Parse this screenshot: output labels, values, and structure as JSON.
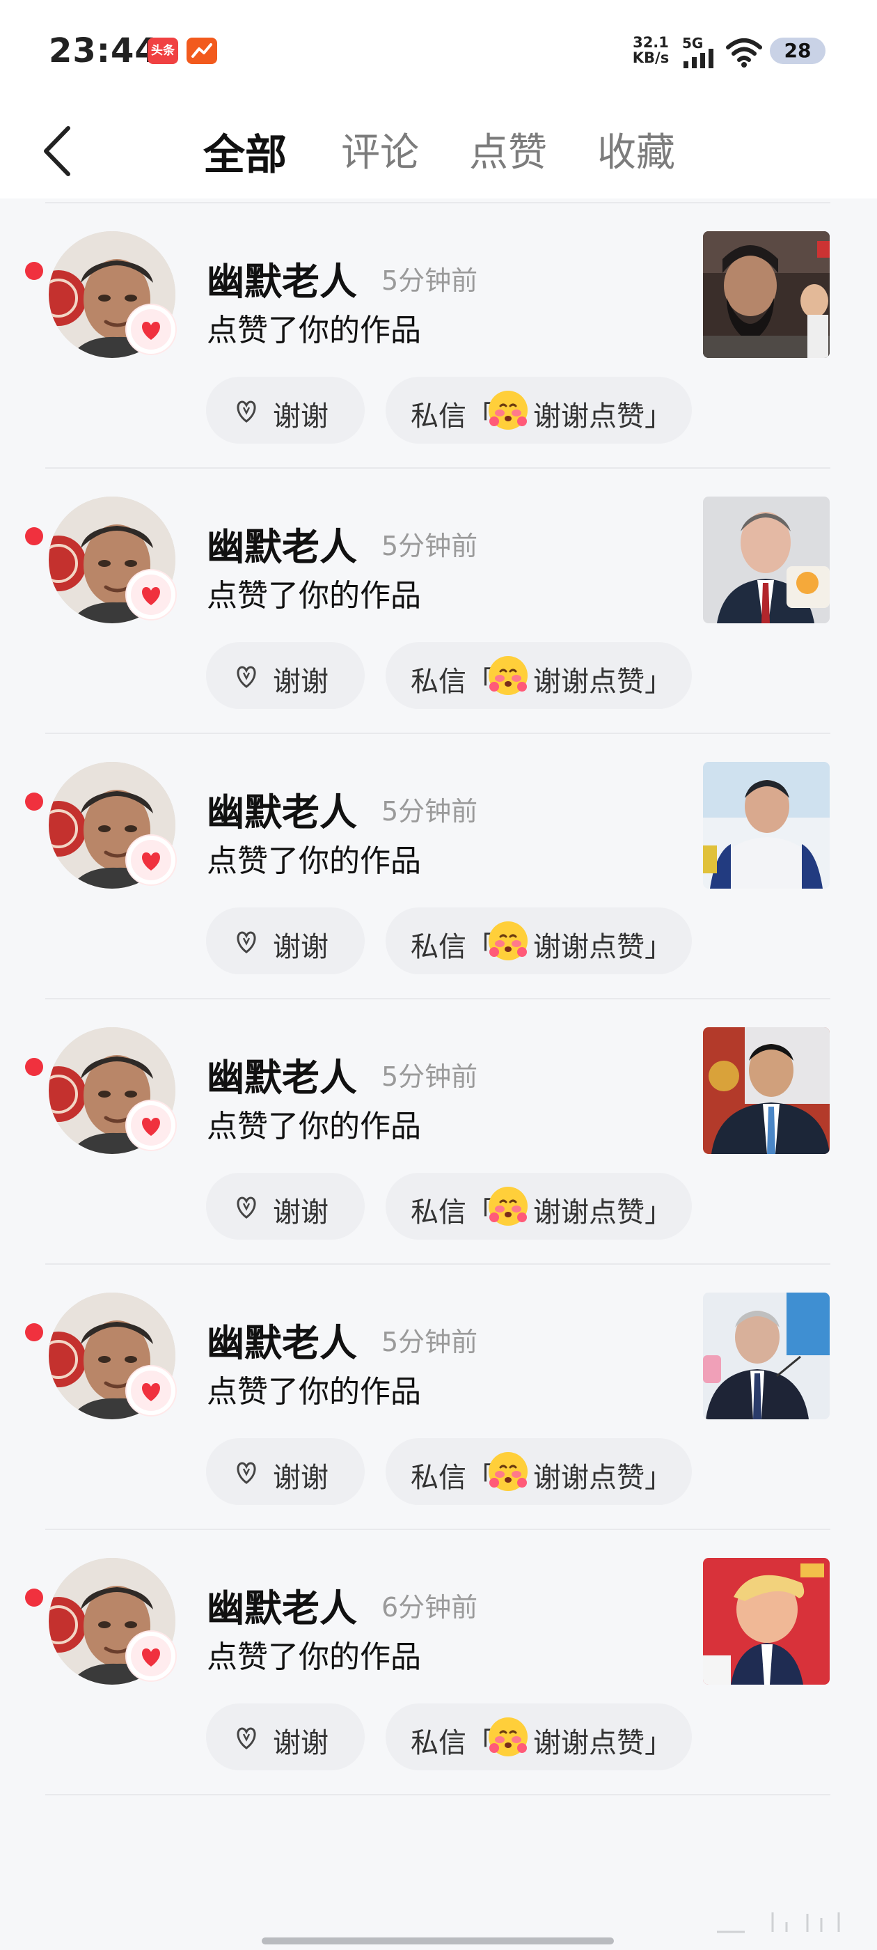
{
  "status_bar": {
    "time": "23:44",
    "app_badge": "头条",
    "net_speed_value": "32.1",
    "net_speed_unit": "KB/s",
    "network": "5G",
    "battery": "28"
  },
  "header": {
    "tabs": [
      {
        "label": "全部",
        "active": true
      },
      {
        "label": "评论",
        "active": false
      },
      {
        "label": "点赞",
        "active": false
      },
      {
        "label": "收藏",
        "active": false
      }
    ]
  },
  "items": [
    {
      "name": "幽默老人",
      "time": "",
      "action": "点赞了你的作品",
      "thanks": "谢谢",
      "dm_prefix": "私信「",
      "dm_message": "谢谢点赞」",
      "unread": false
    },
    {
      "name": "幽默老人",
      "time": "5分钟前",
      "action": "点赞了你的作品",
      "thanks": "谢谢",
      "dm_prefix": "私信「",
      "dm_message": "谢谢点赞」",
      "unread": true
    },
    {
      "name": "幽默老人",
      "time": "5分钟前",
      "action": "点赞了你的作品",
      "thanks": "谢谢",
      "dm_prefix": "私信「",
      "dm_message": "谢谢点赞」",
      "unread": true
    },
    {
      "name": "幽默老人",
      "time": "5分钟前",
      "action": "点赞了你的作品",
      "thanks": "谢谢",
      "dm_prefix": "私信「",
      "dm_message": "谢谢点赞」",
      "unread": true
    },
    {
      "name": "幽默老人",
      "time": "5分钟前",
      "action": "点赞了你的作品",
      "thanks": "谢谢",
      "dm_prefix": "私信「",
      "dm_message": "谢谢点赞」",
      "unread": true
    },
    {
      "name": "幽默老人",
      "time": "5分钟前",
      "action": "点赞了你的作品",
      "thanks": "谢谢",
      "dm_prefix": "私信「",
      "dm_message": "谢谢点赞」",
      "unread": true
    },
    {
      "name": "幽默老人",
      "time": "6分钟前",
      "action": "点赞了你的作品",
      "thanks": "谢谢",
      "dm_prefix": "私信「",
      "dm_message": "谢谢点赞」",
      "unread": true
    }
  ],
  "icons": {
    "back": "chevron-left-icon",
    "like": "heart-icon",
    "thanks": "heart-outline-icon",
    "emoji": "blushing-emoji-icon"
  },
  "colors": {
    "accent_red": "#f0313e",
    "background": "#f6f7f9",
    "pill": "#eeeff2"
  }
}
